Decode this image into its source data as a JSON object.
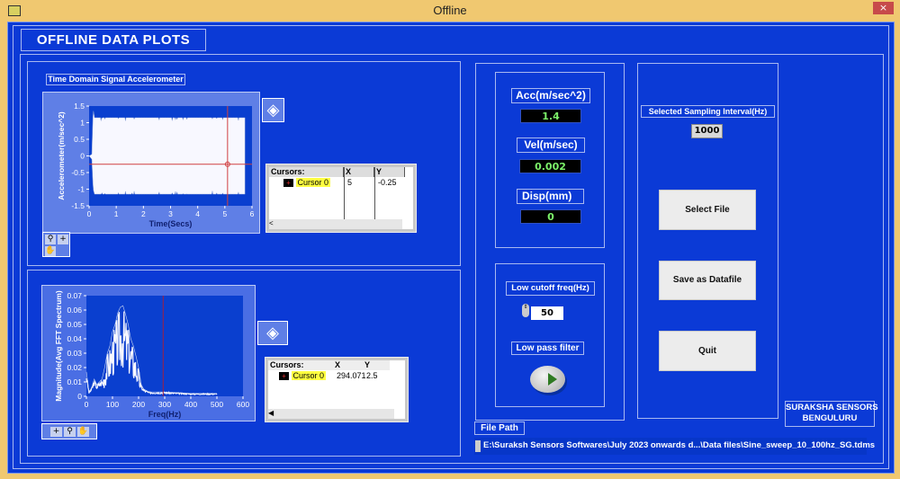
{
  "window": {
    "title": "Offline",
    "close": "×"
  },
  "panel_title": "OFFLINE DATA PLOTS",
  "time_graph": {
    "label": "Time Domain Signal  Accelerometer",
    "cursor_table": {
      "headers": [
        "Cursors:",
        "X",
        "Y"
      ],
      "rows": [
        {
          "name": "Cursor 0",
          "x": "5",
          "y": "-0.25"
        }
      ]
    }
  },
  "fft_graph": {
    "cursor_table": {
      "headers": [
        "Cursors:",
        "X",
        "Y"
      ],
      "rows": [
        {
          "name": "Cursor 0",
          "x": "294.071",
          "y": "2.5"
        }
      ]
    }
  },
  "chart_data": [
    {
      "type": "area",
      "xlabel": "Time(Secs)",
      "ylabel": "Accelerometer(m/sec^2)",
      "xlim": [
        0,
        6
      ],
      "ylim": [
        -1.5,
        1.5
      ],
      "xticks": [
        "0",
        "1",
        "2",
        "3",
        "4",
        "5",
        "6"
      ],
      "yticks": [
        "1.5",
        "1",
        "0.5",
        "0",
        "-0.5",
        "-1",
        "-1.5"
      ],
      "envelope": {
        "t": [
          0,
          0.1,
          0.15,
          0.2,
          5.75
        ],
        "upper": [
          0,
          0.05,
          1.4,
          1.15,
          1.15
        ],
        "lower": [
          0,
          -0.1,
          -1.0,
          -1.15,
          -1.15
        ]
      },
      "cursor": {
        "x": 5.1,
        "y": -0.25
      },
      "colors": {
        "plot_bg": "#0a3fcf",
        "trace": "#f8f8ff",
        "cursor": "#d04040"
      }
    },
    {
      "type": "line",
      "xlabel": "Freq(Hz)",
      "ylabel": "Magnitude(Avg FFT Spectrum)",
      "xlim": [
        0,
        600
      ],
      "ylim": [
        0,
        0.07
      ],
      "xticks": [
        "0",
        "100",
        "200",
        "300",
        "400",
        "500",
        "600"
      ],
      "yticks": [
        "0.07",
        "0.06",
        "0.05",
        "0.04",
        "0.03",
        "0.02",
        "0.01",
        "0"
      ],
      "x": [
        0,
        10,
        20,
        30,
        40,
        50,
        60,
        70,
        80,
        90,
        100,
        110,
        120,
        130,
        140,
        150,
        160,
        170,
        180,
        190,
        200,
        210,
        220,
        230,
        240,
        260,
        300,
        400,
        500
      ],
      "y": [
        0.017,
        0.003,
        0.006,
        0.012,
        0.008,
        0.01,
        0.012,
        0.02,
        0.03,
        0.035,
        0.045,
        0.05,
        0.058,
        0.062,
        0.063,
        0.057,
        0.05,
        0.04,
        0.035,
        0.028,
        0.02,
        0.008,
        0.005,
        0.004,
        0.003,
        0.003,
        0.003,
        0.002,
        0.002
      ],
      "cursor": {
        "x": 294.071
      },
      "colors": {
        "plot_bg": "#0a3fcf",
        "trace": "#f8f8ff",
        "cursor": "#a02040"
      }
    }
  ],
  "measurements": [
    {
      "label": "Acc(m/sec^2)",
      "value": "1.4"
    },
    {
      "label": "Vel(m/sec)",
      "value": "0.002"
    },
    {
      "label": "Disp(mm)",
      "value": "0"
    }
  ],
  "filter": {
    "cutoff_label": "Low cutoff freq(Hz)",
    "cutoff_value": "50",
    "lpf_label": "Low pass filter",
    "lpf_state": "on"
  },
  "sampling": {
    "label": "Selected Sampling Interval(Hz)",
    "value": "1000"
  },
  "buttons": {
    "select": "Select File",
    "save": "Save as Datafile",
    "quit": "Quit"
  },
  "brand": {
    "line1": "SURAKSHA SENSORS",
    "line2": "BENGULURU"
  },
  "file_path": {
    "label": "File Path",
    "value": "E:\\Suraksh Sensors Softwares\\July 2023 onwards d...\\Data files\\Sine_sweep_10_100hz_SG.tdms"
  }
}
